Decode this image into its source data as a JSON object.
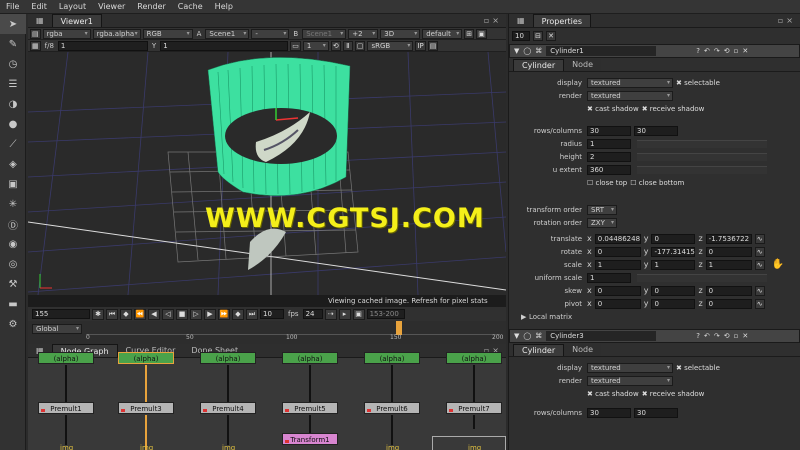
{
  "menu": [
    "File",
    "Edit",
    "Layout",
    "Viewer",
    "Render",
    "Cache",
    "Help"
  ],
  "toolbar_icons": [
    "pointer-icon",
    "paint-icon",
    "clock-icon",
    "channels-icon",
    "color-icon",
    "circle-icon",
    "keyer-icon",
    "merge-icon",
    "3d-icon",
    "particles-icon",
    "deep-icon",
    "views-icon",
    "metadata-icon",
    "toolsets-icon",
    "other-icon",
    "settings-icon"
  ],
  "viewer": {
    "tab": "Viewer1",
    "row1": {
      "channels": "rgba",
      "alpha": "rgba.alpha",
      "display": "RGB",
      "a_label": "A",
      "a_value": "Scene1",
      "op": "-",
      "b_label": "B",
      "b_value": "Scene1",
      "zoom": "+2",
      "mode": "3D",
      "lut": "default"
    },
    "row2": {
      "fstop": "f/8",
      "gain": "1",
      "gamma_label": "Y",
      "gamma": "1",
      "frame": "1",
      "colorspace": "sRGB"
    },
    "status_msg": "Viewing cached image. Refresh for pixel stats"
  },
  "watermark": "WWW.CGTSJ.COM",
  "playback": {
    "frame": "155",
    "step": "10",
    "fps_label": "fps",
    "fps": "24",
    "range": "153-200",
    "mode": "Global"
  },
  "timeline_ticks": [
    "0",
    "50",
    "100",
    "150",
    "200"
  ],
  "nodegraph": {
    "tabs": [
      "Node Graph",
      "Curve Editor",
      "Dope Sheet"
    ],
    "alpha_nodes": [
      "(alpha)",
      "(alpha)",
      "(alpha)",
      "(alpha)",
      "(alpha)",
      "(alpha)"
    ],
    "premult_nodes": [
      "Premult1",
      "Premult3",
      "Premult4",
      "Premult5",
      "Premult6",
      "Premult7"
    ],
    "transform_node": "Transform1",
    "img_labels": [
      "img",
      "img",
      "img",
      "img",
      "img"
    ]
  },
  "properties": {
    "tab": "Properties",
    "max_panels": "10",
    "panel1": {
      "name": "Cylinder1",
      "tabs": [
        "Cylinder",
        "Node"
      ],
      "display_label": "display",
      "display": "textured",
      "selectable": "selectable",
      "render_label": "render",
      "render": "textured",
      "cast_shadow": "cast shadow",
      "receive_shadow": "receive shadow",
      "rows_label": "rows/columns",
      "rows": "30",
      "columns": "30",
      "radius_label": "radius",
      "radius": "1",
      "height_label": "height",
      "height": "2",
      "uextent_label": "u extent",
      "uextent": "360",
      "close_top": "close top",
      "close_bottom": "close bottom",
      "order_label": "transform order",
      "order": "SRT",
      "rot_order_label": "rotation order",
      "rot_order": "ZXY",
      "translate_label": "translate",
      "translate": [
        "0.04486248",
        "0",
        "-1.7536722"
      ],
      "rotate_label": "rotate",
      "rotate": [
        "0",
        "-177.31415",
        "0"
      ],
      "scale_label": "scale",
      "scale": [
        "1",
        "1",
        "1"
      ],
      "uscale_label": "uniform scale",
      "uscale": "1",
      "skew_label": "skew",
      "skew": [
        "0",
        "0",
        "0"
      ],
      "pivot_label": "pivot",
      "pivot": [
        "0",
        "0",
        "0"
      ],
      "local_matrix": "Local matrix",
      "axes": [
        "x",
        "y",
        "z"
      ]
    },
    "panel2": {
      "name": "Cylinder3",
      "tabs": [
        "Cylinder",
        "Node"
      ],
      "display": "textured",
      "selectable": "selectable",
      "render": "textured",
      "cast_shadow": "cast shadow",
      "receive_shadow": "receive shadow",
      "rows_label": "rows/columns",
      "rows": "30",
      "columns": "30"
    }
  },
  "colors": {
    "accent": "#e8a33c",
    "node_green": "#4aa24a",
    "transform_pink": "#d886d0",
    "watermark": "#f4ef1a",
    "cylinder": "#3de0a0"
  }
}
